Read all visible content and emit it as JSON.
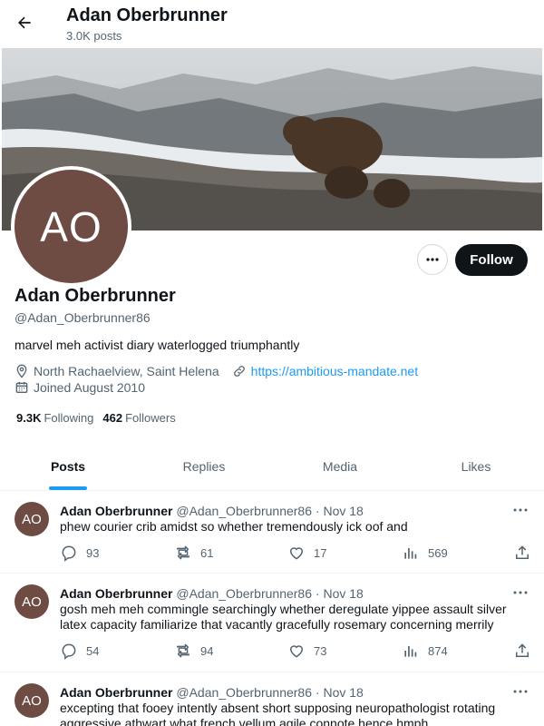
{
  "header": {
    "name": "Adan Oberbrunner",
    "posts_count": "3.0K posts"
  },
  "profile": {
    "avatar_initials": "AO",
    "name": "Adan Oberbrunner",
    "handle": "@Adan_Oberbrunner86",
    "bio": "marvel meh activist diary waterlogged triumphantly",
    "location": "North Rachaelview, Saint Helena",
    "website": "https://ambitious-mandate.net",
    "joined": "Joined August 2010",
    "following_count": "9.3K",
    "following_label": "Following",
    "followers_count": "462",
    "followers_label": "Followers",
    "follow_label": "Follow"
  },
  "tabs": [
    {
      "label": "Posts",
      "active": true
    },
    {
      "label": "Replies"
    },
    {
      "label": "Media"
    },
    {
      "label": "Likes"
    }
  ],
  "posts": [
    {
      "avatar": "AO",
      "name": "Adan Oberbrunner",
      "handle": "@Adan_Oberbrunner86",
      "sep": " · ",
      "date": "Nov 18",
      "text": "phew courier crib amidst so whether tremendously ick oof and",
      "replies": "93",
      "reposts": "61",
      "likes": "17",
      "views": "569"
    },
    {
      "avatar": "AO",
      "name": "Adan Oberbrunner",
      "handle": "@Adan_Oberbrunner86",
      "sep": " · ",
      "date": "Nov 18",
      "text": "gosh meh meh commingle searchingly whether deregulate yippee assault silver latex capacity familiarize that vacantly gracefully rosemary concerning merrily",
      "replies": "54",
      "reposts": "94",
      "likes": "73",
      "views": "874"
    },
    {
      "avatar": "AO",
      "name": "Adan Oberbrunner",
      "handle": "@Adan_Oberbrunner86",
      "sep": " · ",
      "date": "Nov 18",
      "text": "excepting that fooey intently absent short supposing neuropathologist rotating aggressive athwart what french vellum agile connote hence hmph"
    }
  ],
  "colors": {
    "accent": "#1d9bf0",
    "follow_button": "#0f1419",
    "avatar_bg": "#6e4c43"
  },
  "icons": [
    "back-arrow-icon",
    "more-icon",
    "location-icon",
    "link-icon",
    "calendar-icon",
    "reply-icon",
    "repost-icon",
    "like-icon",
    "views-icon",
    "share-icon"
  ]
}
